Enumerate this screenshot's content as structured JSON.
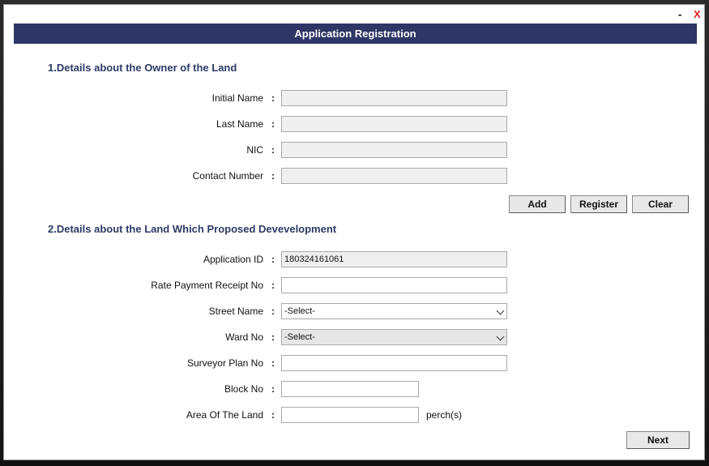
{
  "window": {
    "minimize_label": "-",
    "close_label": "X",
    "title": "Application Registration"
  },
  "section1": {
    "heading": "1.Details about the Owner of the Land",
    "fields": [
      {
        "label": "Initial Name",
        "value": ""
      },
      {
        "label": "Last Name",
        "value": ""
      },
      {
        "label": "NIC",
        "value": ""
      },
      {
        "label": "Contact Number",
        "value": ""
      }
    ],
    "buttons": {
      "add": "Add",
      "register": "Register",
      "clear": "Clear"
    }
  },
  "section2": {
    "heading": "2.Details about the Land Which Proposed Devevelopment",
    "application_id": {
      "label": "Application ID",
      "value": "180324161061"
    },
    "rate_payment_receipt": {
      "label": "Rate Payment Receipt No",
      "value": ""
    },
    "street_name": {
      "label": "Street Name",
      "selected": "-Select-"
    },
    "ward_no": {
      "label": "Ward No",
      "selected": "-Select-"
    },
    "surveyor_plan": {
      "label": "Surveyor Plan No",
      "value": ""
    },
    "block_no": {
      "label": "Block No",
      "value": ""
    },
    "area": {
      "label": "Area Of The Land",
      "value": "",
      "unit": "perch(s)"
    },
    "next_button": "Next"
  },
  "colon": ":"
}
